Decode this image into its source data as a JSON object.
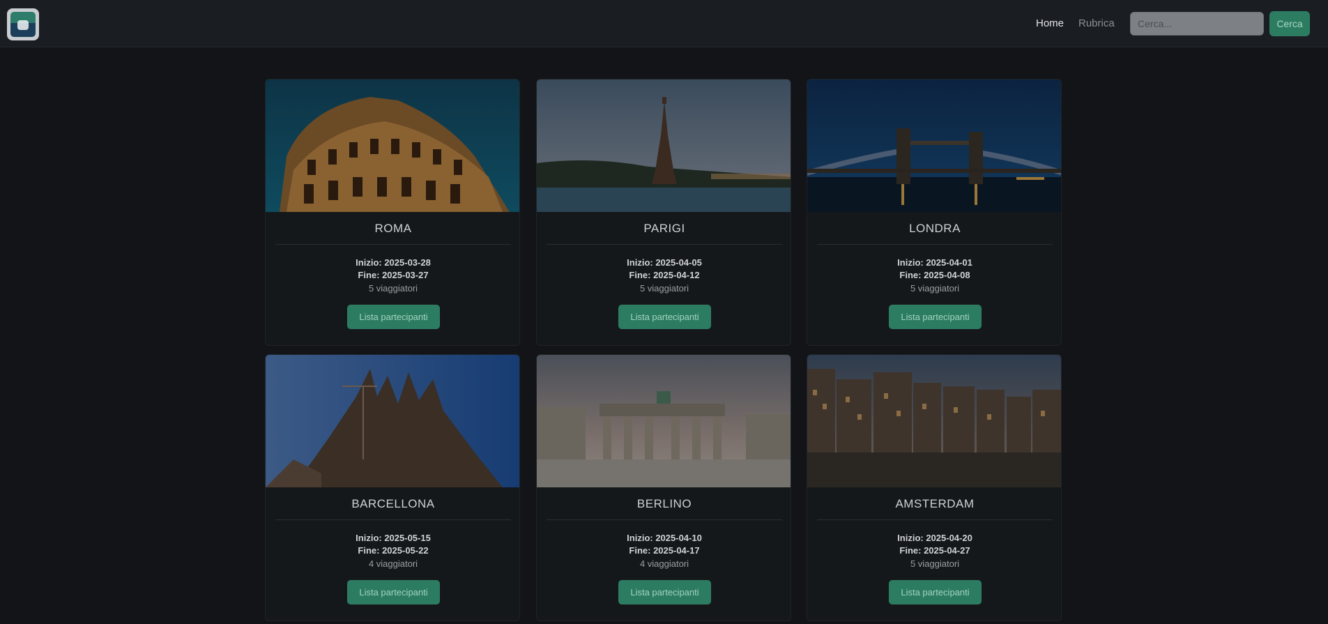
{
  "nav": {
    "logo_icon": "app-logo-icon",
    "links": [
      {
        "label": "Home"
      },
      {
        "label": "Rubrica"
      }
    ],
    "search": {
      "placeholder": "Cerca...",
      "value": ""
    },
    "search_button": "Cerca"
  },
  "accent_color": "#2c7c61",
  "cards": [
    {
      "city": "ROMA",
      "start": "Inizio: 2025-03-28",
      "end": "Fine: 2025-03-27",
      "trips": "5 viaggiatori",
      "button": "Lista partecipanti",
      "image": "colosseum-photo"
    },
    {
      "city": "PARIGI",
      "start": "Inizio: 2025-04-05",
      "end": "Fine: 2025-04-12",
      "trips": "5 viaggiatori",
      "button": "Lista partecipanti",
      "image": "eiffel-tower-photo"
    },
    {
      "city": "LONDRA",
      "start": "Inizio: 2025-04-01",
      "end": "Fine: 2025-04-08",
      "trips": "5 viaggiatori",
      "button": "Lista partecipanti",
      "image": "tower-bridge-photo"
    },
    {
      "city": "BARCELLONA",
      "start": "Inizio: 2025-05-15",
      "end": "Fine: 2025-05-22",
      "trips": "4 viaggiatori",
      "button": "Lista partecipanti",
      "image": "sagrada-familia-photo"
    },
    {
      "city": "BERLINO",
      "start": "Inizio: 2025-04-10",
      "end": "Fine: 2025-04-17",
      "trips": "4 viaggiatori",
      "button": "Lista partecipanti",
      "image": "brandenburg-gate-photo"
    },
    {
      "city": "AMSTERDAM",
      "start": "Inizio: 2025-04-20",
      "end": "Fine: 2025-04-27",
      "trips": "5 viaggiatori",
      "button": "Lista partecipanti",
      "image": "amsterdam-canal-photo"
    }
  ]
}
